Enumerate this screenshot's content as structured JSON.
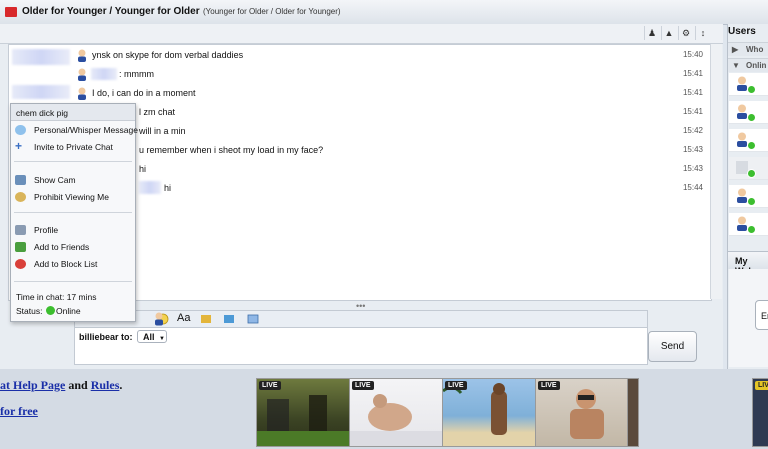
{
  "window": {
    "title": "Older for Younger / Younger for Older",
    "subtitle": "(Younger for Older / Older for Younger)"
  },
  "messages": [
    {
      "text": "ynsk on skype for dom verbal daddies",
      "time": "15:40"
    },
    {
      "text": ": mmmm",
      "time": "15:41"
    },
    {
      "text": "I do, i can do in a moment",
      "time": "15:41"
    },
    {
      "text": "l zm chat",
      "time": "15:41"
    },
    {
      "text": "will in a min",
      "time": "15:42"
    },
    {
      "text": "u remember when i sheot my load in my face?",
      "time": "15:43"
    },
    {
      "text": "hi",
      "time": "15:43"
    },
    {
      "text": "hi",
      "time": "15:44"
    }
  ],
  "context_menu": {
    "username": "chem dick pig",
    "items": [
      {
        "label": "Personal/Whisper Message",
        "icon": "speech-bubble-icon"
      },
      {
        "label": "Invite to Private Chat",
        "icon": "plus-icon"
      },
      {
        "label": "Show Cam",
        "icon": "webcam-icon"
      },
      {
        "label": "Prohibit Viewing Me",
        "icon": "eye-icon"
      },
      {
        "label": "Profile",
        "icon": "profile-icon"
      },
      {
        "label": "Add to Friends",
        "icon": "add-friend-icon"
      },
      {
        "label": "Add to Block List",
        "icon": "block-icon"
      }
    ],
    "time_in_chat": "Time in chat: 17 mins",
    "status_label": "Status:",
    "status_value": "Online"
  },
  "input": {
    "to_label": "billiebear to:",
    "to_value": "All",
    "send_label": "Send",
    "font_label": "Aa"
  },
  "users_panel": {
    "title": "Users",
    "groups": [
      "Who",
      "Onlin"
    ],
    "webcam_title": "My Web",
    "webcam_button": "Er"
  },
  "bottom": {
    "help_prefix": "at Help Page",
    "and": " and ",
    "rules": "Rules",
    "period": ".",
    "free": "for free",
    "live_label": "LIVE"
  },
  "colors": {
    "accent_red": "#d8282b",
    "link_blue": "#1a2fa8",
    "online_green": "#3cbe2f",
    "live_badge_yellow": "#e5c526"
  }
}
